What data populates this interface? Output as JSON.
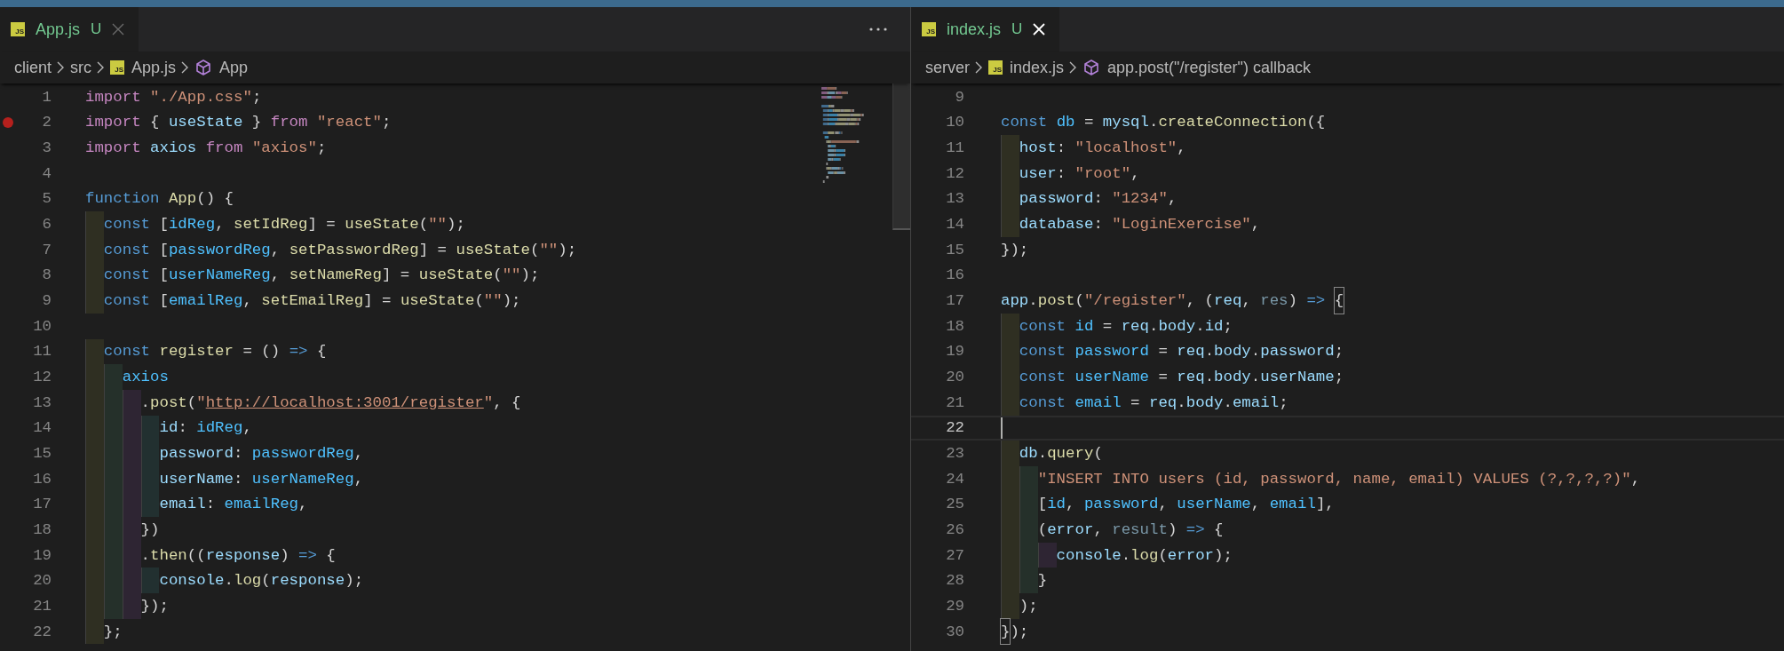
{
  "panes": [
    {
      "tab": {
        "icon_text": "JS",
        "label": "App.js",
        "status": "U",
        "selected": true,
        "group_active": false
      },
      "more_actions": true,
      "breadcrumbs": [
        {
          "label": "client",
          "kind": "folder"
        },
        {
          "label": "src",
          "kind": "folder"
        },
        {
          "label": "App.js",
          "kind": "file",
          "icon_text": "JS"
        },
        {
          "label": "App",
          "kind": "symbol"
        }
      ],
      "minimap": true,
      "lines": [
        {
          "n": "1",
          "breakpoint": false,
          "current": false,
          "code": [
            {
              "kind": "kw",
              "text": "import "
            },
            {
              "kind": "str",
              "text": "\"./App.css\""
            },
            {
              "kind": "p",
              "text": ";"
            }
          ]
        },
        {
          "n": "2",
          "breakpoint": true,
          "current": false,
          "code": [
            {
              "kind": "kw",
              "text": "import "
            },
            {
              "kind": "p",
              "text": "{ "
            },
            {
              "kind": "var",
              "text": "useState"
            },
            {
              "kind": "p",
              "text": " } "
            },
            {
              "kind": "kw",
              "text": "from "
            },
            {
              "kind": "str",
              "text": "\"react\""
            },
            {
              "kind": "p",
              "text": ";"
            }
          ]
        },
        {
          "n": "3",
          "breakpoint": false,
          "current": false,
          "code": [
            {
              "kind": "kw",
              "text": "import "
            },
            {
              "kind": "var",
              "text": "axios "
            },
            {
              "kind": "kw",
              "text": "from "
            },
            {
              "kind": "str",
              "text": "\"axios\""
            },
            {
              "kind": "p",
              "text": ";"
            }
          ]
        },
        {
          "n": "4",
          "breakpoint": false,
          "current": false
        },
        {
          "n": "5",
          "breakpoint": false,
          "current": false,
          "code": [
            {
              "kind": "st",
              "text": "function "
            },
            {
              "kind": "fn",
              "text": "App"
            },
            {
              "kind": "p",
              "text": "() {"
            }
          ]
        },
        {
          "n": "6",
          "breakpoint": false,
          "current": false,
          "code": [
            {
              "kind": "st",
              "text": "  const "
            },
            {
              "kind": "p",
              "text": "["
            },
            {
              "kind": "const",
              "text": "idReg"
            },
            {
              "kind": "p",
              "text": ", "
            },
            {
              "kind": "fn",
              "text": "setIdReg"
            },
            {
              "kind": "p",
              "text": "] = "
            },
            {
              "kind": "fn",
              "text": "useState"
            },
            {
              "kind": "p",
              "text": "("
            },
            {
              "kind": "str",
              "text": "\"\""
            },
            {
              "kind": "p",
              "text": ");"
            }
          ]
        },
        {
          "n": "7",
          "breakpoint": false,
          "current": false,
          "code": [
            {
              "kind": "st",
              "text": "  const "
            },
            {
              "kind": "p",
              "text": "["
            },
            {
              "kind": "const",
              "text": "passwordReg"
            },
            {
              "kind": "p",
              "text": ", "
            },
            {
              "kind": "fn",
              "text": "setPasswordReg"
            },
            {
              "kind": "p",
              "text": "] = "
            },
            {
              "kind": "fn",
              "text": "useState"
            },
            {
              "kind": "p",
              "text": "("
            },
            {
              "kind": "str",
              "text": "\"\""
            },
            {
              "kind": "p",
              "text": ");"
            }
          ]
        },
        {
          "n": "8",
          "breakpoint": false,
          "current": false,
          "code": [
            {
              "kind": "st",
              "text": "  const "
            },
            {
              "kind": "p",
              "text": "["
            },
            {
              "kind": "const",
              "text": "userNameReg"
            },
            {
              "kind": "p",
              "text": ", "
            },
            {
              "kind": "fn",
              "text": "setNameReg"
            },
            {
              "kind": "p",
              "text": "] = "
            },
            {
              "kind": "fn",
              "text": "useState"
            },
            {
              "kind": "p",
              "text": "("
            },
            {
              "kind": "str",
              "text": "\"\""
            },
            {
              "kind": "p",
              "text": ");"
            }
          ]
        },
        {
          "n": "9",
          "breakpoint": false,
          "current": false,
          "code": [
            {
              "kind": "st",
              "text": "  const "
            },
            {
              "kind": "p",
              "text": "["
            },
            {
              "kind": "const",
              "text": "emailReg"
            },
            {
              "kind": "p",
              "text": ", "
            },
            {
              "kind": "fn",
              "text": "setEmailReg"
            },
            {
              "kind": "p",
              "text": "] = "
            },
            {
              "kind": "fn",
              "text": "useState"
            },
            {
              "kind": "p",
              "text": "("
            },
            {
              "kind": "str",
              "text": "\"\""
            },
            {
              "kind": "p",
              "text": ");"
            }
          ]
        },
        {
          "n": "10",
          "breakpoint": false,
          "current": false
        },
        {
          "n": "11",
          "breakpoint": false,
          "current": false,
          "code": [
            {
              "kind": "st",
              "text": "  const "
            },
            {
              "kind": "fn",
              "text": "register"
            },
            {
              "kind": "p",
              "text": " = () "
            },
            {
              "kind": "st",
              "text": "=>"
            },
            {
              "kind": "p",
              "text": " {"
            }
          ]
        },
        {
          "n": "12",
          "breakpoint": false,
          "current": false,
          "code": [
            {
              "kind": "const",
              "text": "    axios"
            }
          ]
        },
        {
          "n": "13",
          "breakpoint": false,
          "current": false,
          "code": [
            {
              "kind": "p",
              "text": "      ."
            },
            {
              "kind": "fn",
              "text": "post"
            },
            {
              "kind": "p",
              "text": "("
            },
            {
              "kind": "str",
              "text": "\""
            },
            {
              "kind": "url",
              "text": "http://localhost:3001/register"
            },
            {
              "kind": "str",
              "text": "\""
            },
            {
              "kind": "p",
              "text": ", {"
            }
          ]
        },
        {
          "n": "14",
          "breakpoint": false,
          "current": false,
          "code": [
            {
              "kind": "var",
              "text": "        id"
            },
            {
              "kind": "p",
              "text": ": "
            },
            {
              "kind": "const",
              "text": "idReg"
            },
            {
              "kind": "p",
              "text": ","
            }
          ]
        },
        {
          "n": "15",
          "breakpoint": false,
          "current": false,
          "code": [
            {
              "kind": "var",
              "text": "        password"
            },
            {
              "kind": "p",
              "text": ": "
            },
            {
              "kind": "const",
              "text": "passwordReg"
            },
            {
              "kind": "p",
              "text": ","
            }
          ]
        },
        {
          "n": "16",
          "breakpoint": false,
          "current": false,
          "code": [
            {
              "kind": "var",
              "text": "        userName"
            },
            {
              "kind": "p",
              "text": ": "
            },
            {
              "kind": "const",
              "text": "userNameReg"
            },
            {
              "kind": "p",
              "text": ","
            }
          ]
        },
        {
          "n": "17",
          "breakpoint": false,
          "current": false,
          "code": [
            {
              "kind": "var",
              "text": "        email"
            },
            {
              "kind": "p",
              "text": ": "
            },
            {
              "kind": "const",
              "text": "emailReg"
            },
            {
              "kind": "p",
              "text": ","
            }
          ]
        },
        {
          "n": "18",
          "breakpoint": false,
          "current": false,
          "code": [
            {
              "kind": "p",
              "text": "      })"
            }
          ]
        },
        {
          "n": "19",
          "breakpoint": false,
          "current": false,
          "code": [
            {
              "kind": "p",
              "text": "      ."
            },
            {
              "kind": "fn",
              "text": "then"
            },
            {
              "kind": "p",
              "text": "(("
            },
            {
              "kind": "var",
              "text": "response"
            },
            {
              "kind": "p",
              "text": ") "
            },
            {
              "kind": "st",
              "text": "=>"
            },
            {
              "kind": "p",
              "text": " {"
            }
          ]
        },
        {
          "n": "20",
          "breakpoint": false,
          "current": false,
          "code": [
            {
              "kind": "var",
              "text": "        console"
            },
            {
              "kind": "p",
              "text": "."
            },
            {
              "kind": "fn",
              "text": "log"
            },
            {
              "kind": "p",
              "text": "("
            },
            {
              "kind": "var",
              "text": "response"
            },
            {
              "kind": "p",
              "text": ");"
            }
          ]
        },
        {
          "n": "21",
          "breakpoint": false,
          "current": false,
          "code": [
            {
              "kind": "p",
              "text": "      });"
            }
          ]
        },
        {
          "n": "22",
          "breakpoint": false,
          "current": false,
          "code": [
            {
              "kind": "p",
              "text": "  };"
            }
          ]
        }
      ]
    },
    {
      "tab": {
        "icon_text": "JS",
        "label": "index.js",
        "status": "U",
        "selected": true,
        "group_active": true
      },
      "more_actions": false,
      "breadcrumbs": [
        {
          "label": "server",
          "kind": "folder"
        },
        {
          "label": "index.js",
          "kind": "file",
          "icon_text": "JS"
        },
        {
          "label": "app.post(\"/register\") callback",
          "kind": "symbol"
        }
      ],
      "minimap": false,
      "lines": [
        {
          "n": "9",
          "breakpoint": false,
          "current": false
        },
        {
          "n": "10",
          "breakpoint": false,
          "current": false,
          "code": [
            {
              "kind": "st",
              "text": "const "
            },
            {
              "kind": "const",
              "text": "db"
            },
            {
              "kind": "p",
              "text": " = "
            },
            {
              "kind": "var",
              "text": "mysql"
            },
            {
              "kind": "p",
              "text": "."
            },
            {
              "kind": "fn",
              "text": "createConnection"
            },
            {
              "kind": "p",
              "text": "({"
            }
          ]
        },
        {
          "n": "11",
          "breakpoint": false,
          "current": false,
          "code": [
            {
              "kind": "var",
              "text": "  host"
            },
            {
              "kind": "p",
              "text": ": "
            },
            {
              "kind": "str",
              "text": "\"localhost\""
            },
            {
              "kind": "p",
              "text": ","
            }
          ]
        },
        {
          "n": "12",
          "breakpoint": false,
          "current": false,
          "code": [
            {
              "kind": "var",
              "text": "  user"
            },
            {
              "kind": "p",
              "text": ": "
            },
            {
              "kind": "str",
              "text": "\"root\""
            },
            {
              "kind": "p",
              "text": ","
            }
          ]
        },
        {
          "n": "13",
          "breakpoint": false,
          "current": false,
          "code": [
            {
              "kind": "var",
              "text": "  password"
            },
            {
              "kind": "p",
              "text": ": "
            },
            {
              "kind": "str",
              "text": "\"1234\""
            },
            {
              "kind": "p",
              "text": ","
            }
          ]
        },
        {
          "n": "14",
          "breakpoint": false,
          "current": false,
          "code": [
            {
              "kind": "var",
              "text": "  database"
            },
            {
              "kind": "p",
              "text": ": "
            },
            {
              "kind": "str",
              "text": "\"LoginExercise\""
            },
            {
              "kind": "p",
              "text": ","
            }
          ]
        },
        {
          "n": "15",
          "breakpoint": false,
          "current": false,
          "code": [
            {
              "kind": "p",
              "text": "});"
            }
          ]
        },
        {
          "n": "16",
          "breakpoint": false,
          "current": false
        },
        {
          "n": "17",
          "breakpoint": false,
          "current": false,
          "code": [
            {
              "kind": "var",
              "text": "app"
            },
            {
              "kind": "p",
              "text": "."
            },
            {
              "kind": "fn",
              "text": "post"
            },
            {
              "kind": "p",
              "text": "("
            },
            {
              "kind": "str",
              "text": "\"/register\""
            },
            {
              "kind": "p",
              "text": ", ("
            },
            {
              "kind": "var",
              "text": "req"
            },
            {
              "kind": "p",
              "text": ", "
            },
            {
              "kind": "dim",
              "text": "res"
            },
            {
              "kind": "p",
              "text": ") "
            },
            {
              "kind": "st",
              "text": "=> "
            },
            {
              "kind": "match",
              "text": "{"
            }
          ]
        },
        {
          "n": "18",
          "breakpoint": false,
          "current": false,
          "code": [
            {
              "kind": "st",
              "text": "  const "
            },
            {
              "kind": "const",
              "text": "id"
            },
            {
              "kind": "p",
              "text": " = "
            },
            {
              "kind": "var",
              "text": "req"
            },
            {
              "kind": "p",
              "text": "."
            },
            {
              "kind": "var",
              "text": "body"
            },
            {
              "kind": "p",
              "text": "."
            },
            {
              "kind": "var",
              "text": "id"
            },
            {
              "kind": "p",
              "text": ";"
            }
          ]
        },
        {
          "n": "19",
          "breakpoint": false,
          "current": false,
          "code": [
            {
              "kind": "st",
              "text": "  const "
            },
            {
              "kind": "const",
              "text": "password"
            },
            {
              "kind": "p",
              "text": " = "
            },
            {
              "kind": "var",
              "text": "req"
            },
            {
              "kind": "p",
              "text": "."
            },
            {
              "kind": "var",
              "text": "body"
            },
            {
              "kind": "p",
              "text": "."
            },
            {
              "kind": "var",
              "text": "password"
            },
            {
              "kind": "p",
              "text": ";"
            }
          ]
        },
        {
          "n": "20",
          "breakpoint": false,
          "current": false,
          "code": [
            {
              "kind": "st",
              "text": "  const "
            },
            {
              "kind": "const",
              "text": "userName"
            },
            {
              "kind": "p",
              "text": " = "
            },
            {
              "kind": "var",
              "text": "req"
            },
            {
              "kind": "p",
              "text": "."
            },
            {
              "kind": "var",
              "text": "body"
            },
            {
              "kind": "p",
              "text": "."
            },
            {
              "kind": "var",
              "text": "userName"
            },
            {
              "kind": "p",
              "text": ";"
            }
          ]
        },
        {
          "n": "21",
          "breakpoint": false,
          "current": false,
          "code": [
            {
              "kind": "st",
              "text": "  const "
            },
            {
              "kind": "const",
              "text": "email"
            },
            {
              "kind": "p",
              "text": " = "
            },
            {
              "kind": "var",
              "text": "req"
            },
            {
              "kind": "p",
              "text": "."
            },
            {
              "kind": "var",
              "text": "body"
            },
            {
              "kind": "p",
              "text": "."
            },
            {
              "kind": "var",
              "text": "email"
            },
            {
              "kind": "p",
              "text": ";"
            }
          ]
        },
        {
          "n": "22",
          "breakpoint": false,
          "current": true
        },
        {
          "n": "23",
          "breakpoint": false,
          "current": false,
          "code": [
            {
              "kind": "var",
              "text": "  db"
            },
            {
              "kind": "p",
              "text": "."
            },
            {
              "kind": "fn",
              "text": "query"
            },
            {
              "kind": "p",
              "text": "("
            }
          ]
        },
        {
          "n": "24",
          "breakpoint": false,
          "current": false,
          "code": [
            {
              "kind": "str",
              "text": "    \"INSERT INTO users (id, password, name, email) VALUES (?,?,?,?)\""
            },
            {
              "kind": "p",
              "text": ","
            }
          ]
        },
        {
          "n": "25",
          "breakpoint": false,
          "current": false,
          "code": [
            {
              "kind": "p",
              "text": "    ["
            },
            {
              "kind": "const",
              "text": "id"
            },
            {
              "kind": "p",
              "text": ", "
            },
            {
              "kind": "const",
              "text": "password"
            },
            {
              "kind": "p",
              "text": ", "
            },
            {
              "kind": "const",
              "text": "userName"
            },
            {
              "kind": "p",
              "text": ", "
            },
            {
              "kind": "const",
              "text": "email"
            },
            {
              "kind": "p",
              "text": "],"
            }
          ]
        },
        {
          "n": "26",
          "breakpoint": false,
          "current": false,
          "code": [
            {
              "kind": "p",
              "text": "    ("
            },
            {
              "kind": "var",
              "text": "error"
            },
            {
              "kind": "p",
              "text": ", "
            },
            {
              "kind": "dim",
              "text": "result"
            },
            {
              "kind": "p",
              "text": ") "
            },
            {
              "kind": "st",
              "text": "=>"
            },
            {
              "kind": "p",
              "text": " {"
            }
          ]
        },
        {
          "n": "27",
          "breakpoint": false,
          "current": false,
          "code": [
            {
              "kind": "var",
              "text": "      console"
            },
            {
              "kind": "p",
              "text": "."
            },
            {
              "kind": "fn",
              "text": "log"
            },
            {
              "kind": "p",
              "text": "("
            },
            {
              "kind": "var",
              "text": "error"
            },
            {
              "kind": "p",
              "text": ");"
            }
          ]
        },
        {
          "n": "28",
          "breakpoint": false,
          "current": false,
          "code": [
            {
              "kind": "p",
              "text": "    }"
            }
          ]
        },
        {
          "n": "29",
          "breakpoint": false,
          "current": false,
          "code": [
            {
              "kind": "p",
              "text": "  );"
            }
          ]
        },
        {
          "n": "30",
          "breakpoint": false,
          "current": false,
          "code": [
            {
              "kind": "match",
              "text": "}"
            },
            {
              "kind": "p",
              "text": ");"
            }
          ]
        }
      ]
    }
  ]
}
